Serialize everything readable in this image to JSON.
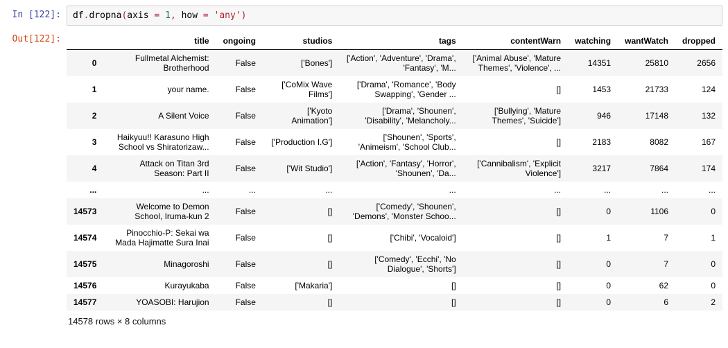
{
  "input": {
    "prompt_prefix": "In [",
    "prompt_num": "122",
    "prompt_suffix": "]:",
    "code_tokens": [
      {
        "t": "id",
        "v": "df"
      },
      {
        "t": "op",
        "v": "."
      },
      {
        "t": "id",
        "v": "dropna"
      },
      {
        "t": "op",
        "v": "("
      },
      {
        "t": "id",
        "v": "axis"
      },
      {
        "t": "op",
        "v": " "
      },
      {
        "t": "op",
        "v": "="
      },
      {
        "t": "op",
        "v": " "
      },
      {
        "t": "num",
        "v": "1"
      },
      {
        "t": "op",
        "v": ","
      },
      {
        "t": "op",
        "v": " "
      },
      {
        "t": "id",
        "v": "how"
      },
      {
        "t": "op",
        "v": " "
      },
      {
        "t": "op",
        "v": "="
      },
      {
        "t": "op",
        "v": " "
      },
      {
        "t": "str",
        "v": "'any'"
      },
      {
        "t": "op",
        "v": ")"
      }
    ]
  },
  "output": {
    "prompt_prefix": "Out[",
    "prompt_num": "122",
    "prompt_suffix": "]:",
    "columns": [
      "",
      "title",
      "ongoing",
      "studios",
      "tags",
      "contentWarn",
      "watching",
      "wantWatch",
      "dropped"
    ],
    "rows": [
      {
        "idx": "0",
        "title": "Fullmetal Alchemist: Brotherhood",
        "ongoing": "False",
        "studios": "['Bones']",
        "tags": "['Action', 'Adventure', 'Drama', 'Fantasy', 'M...",
        "cw": "['Animal Abuse', 'Mature Themes', 'Violence', ...",
        "watching": "14351",
        "want": "25810",
        "dropped": "2656"
      },
      {
        "idx": "1",
        "title": "your name.",
        "ongoing": "False",
        "studios": "['CoMix Wave Films']",
        "tags": "['Drama', 'Romance', 'Body Swapping', 'Gender ...",
        "cw": "[]",
        "watching": "1453",
        "want": "21733",
        "dropped": "124"
      },
      {
        "idx": "2",
        "title": "A Silent Voice",
        "ongoing": "False",
        "studios": "['Kyoto Animation']",
        "tags": "['Drama', 'Shounen', 'Disability', 'Melancholy...",
        "cw": "['Bullying', 'Mature Themes', 'Suicide']",
        "watching": "946",
        "want": "17148",
        "dropped": "132"
      },
      {
        "idx": "3",
        "title": "Haikyuu!! Karasuno High School vs Shiratorizaw...",
        "ongoing": "False",
        "studios": "['Production I.G']",
        "tags": "['Shounen', 'Sports', 'Animeism', 'School Club...",
        "cw": "[]",
        "watching": "2183",
        "want": "8082",
        "dropped": "167"
      },
      {
        "idx": "4",
        "title": "Attack on Titan 3rd Season: Part II",
        "ongoing": "False",
        "studios": "['Wit Studio']",
        "tags": "['Action', 'Fantasy', 'Horror', 'Shounen', 'Da...",
        "cw": "['Cannibalism', 'Explicit Violence']",
        "watching": "3217",
        "want": "7864",
        "dropped": "174"
      },
      {
        "idx": "...",
        "title": "...",
        "ongoing": "...",
        "studios": "...",
        "tags": "...",
        "cw": "...",
        "watching": "...",
        "want": "...",
        "dropped": "..."
      },
      {
        "idx": "14573",
        "title": "Welcome to Demon School, Iruma-kun 2",
        "ongoing": "False",
        "studios": "[]",
        "tags": "['Comedy', 'Shounen', 'Demons', 'Monster Schoo...",
        "cw": "[]",
        "watching": "0",
        "want": "1106",
        "dropped": "0"
      },
      {
        "idx": "14574",
        "title": "Pinocchio-P: Sekai wa Mada Hajimatte Sura Inai",
        "ongoing": "False",
        "studios": "[]",
        "tags": "['Chibi', 'Vocaloid']",
        "cw": "[]",
        "watching": "1",
        "want": "7",
        "dropped": "1"
      },
      {
        "idx": "14575",
        "title": "Minagoroshi",
        "ongoing": "False",
        "studios": "[]",
        "tags": "['Comedy', 'Ecchi', 'No Dialogue', 'Shorts']",
        "cw": "[]",
        "watching": "0",
        "want": "7",
        "dropped": "0"
      },
      {
        "idx": "14576",
        "title": "Kurayukaba",
        "ongoing": "False",
        "studios": "['Makaria']",
        "tags": "[]",
        "cw": "[]",
        "watching": "0",
        "want": "62",
        "dropped": "0"
      },
      {
        "idx": "14577",
        "title": "YOASOBI: Harujion",
        "ongoing": "False",
        "studios": "[]",
        "tags": "[]",
        "cw": "[]",
        "watching": "0",
        "want": "6",
        "dropped": "2"
      }
    ],
    "dimensions": "14578 rows × 8 columns"
  }
}
